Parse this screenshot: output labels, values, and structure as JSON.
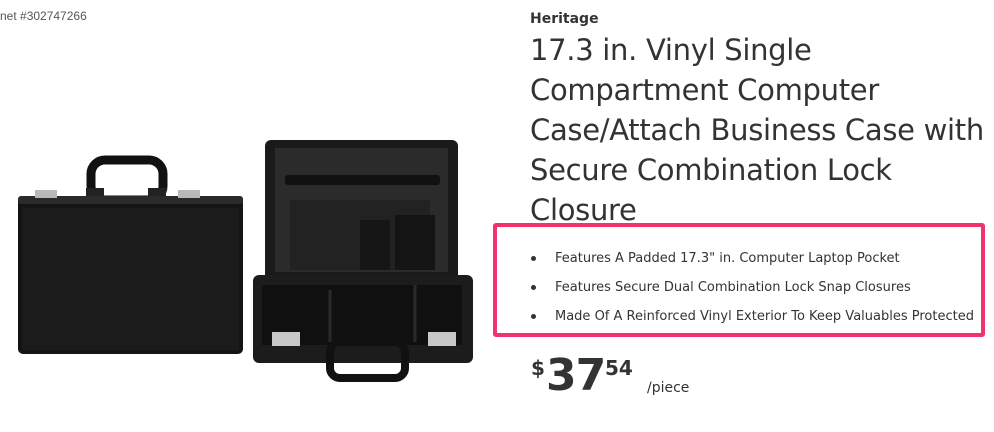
{
  "internet_number": "net #302747266",
  "brand": "Heritage",
  "title": "17.3 in. Vinyl Single Compartment Computer Case/Attach Business Case with Secure Combination Lock Closure",
  "features": [
    "Features A Padded 17.3\" in. Computer Laptop Pocket",
    "Features Secure Dual Combination Lock Snap Closures",
    "Made Of A Reinforced Vinyl Exterior To Keep Valuables Protected"
  ],
  "price": {
    "currency": "$",
    "dollars": "37",
    "cents": "54",
    "unit": "/piece"
  },
  "colors": {
    "highlight_border": "#f0336c",
    "text": "#333333"
  }
}
